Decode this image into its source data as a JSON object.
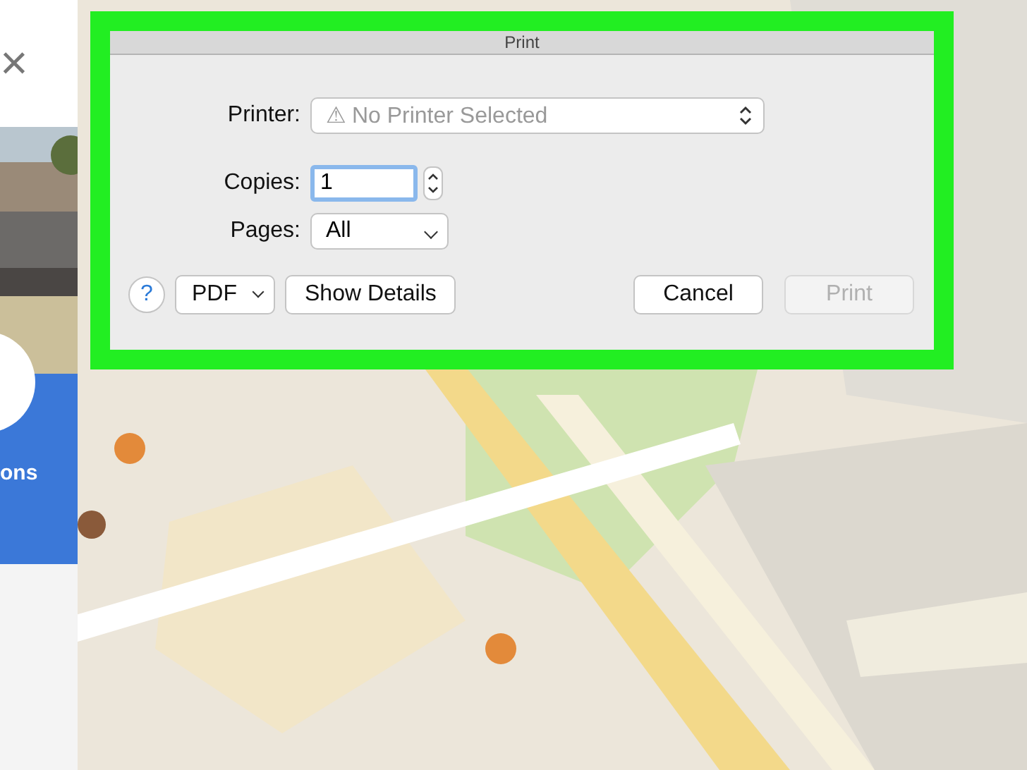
{
  "side_panel": {
    "close": "×",
    "action_label": "ons"
  },
  "dialog": {
    "title": "Print",
    "printer": {
      "label": "Printer:",
      "warning": "⚠",
      "value": "No Printer Selected"
    },
    "copies": {
      "label": "Copies:",
      "value": "1"
    },
    "pages": {
      "label": "Pages:",
      "value": "All"
    },
    "help": "?",
    "pdf": "PDF",
    "show_details": {
      "label": "Show Details",
      "disabled": false
    },
    "cancel": {
      "label": "Cancel",
      "disabled": false
    },
    "print": {
      "label": "Print",
      "disabled": true
    }
  }
}
